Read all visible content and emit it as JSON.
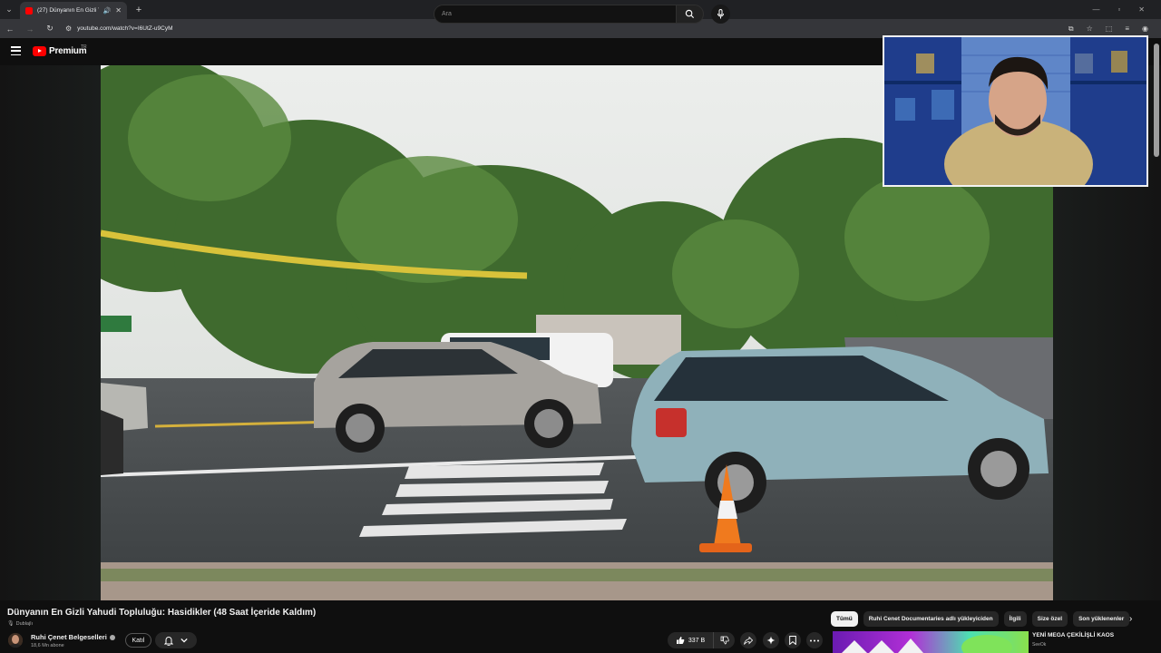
{
  "browser": {
    "tab_title": "(27) Dünyanın En Gizli Yah...",
    "url": "youtube.com/watch?v=I6UtZ-u9CyM"
  },
  "header": {
    "brand": "Premium",
    "country": "TR",
    "search_placeholder": "Ara"
  },
  "video": {
    "title": "Dünyanın En Gizli Yahudi Topluluğu: Hasidikler (48 Saat İçeride Kaldım)",
    "dubbed_label": "Dublajlı"
  },
  "channel": {
    "name": "Ruhi Çenet Belgeselleri",
    "subscribers": "18,6 Mn abone",
    "join_label": "Katıl"
  },
  "actions": {
    "like_count": "337 B"
  },
  "filters": {
    "chips": [
      "Tümü",
      "Ruhi Cenet Documentaries adlı yükleyiciden",
      "İlgili",
      "Size özel",
      "Son yüklenenler"
    ]
  },
  "recommendation": {
    "title": "YENİ MEGA ÇEKİLİŞLİ KAOS",
    "channel": "SeeOk"
  },
  "colors": {
    "background": "#0f0f0f",
    "brand_red": "#ff0000",
    "chip_active": "#f1f1f1"
  }
}
